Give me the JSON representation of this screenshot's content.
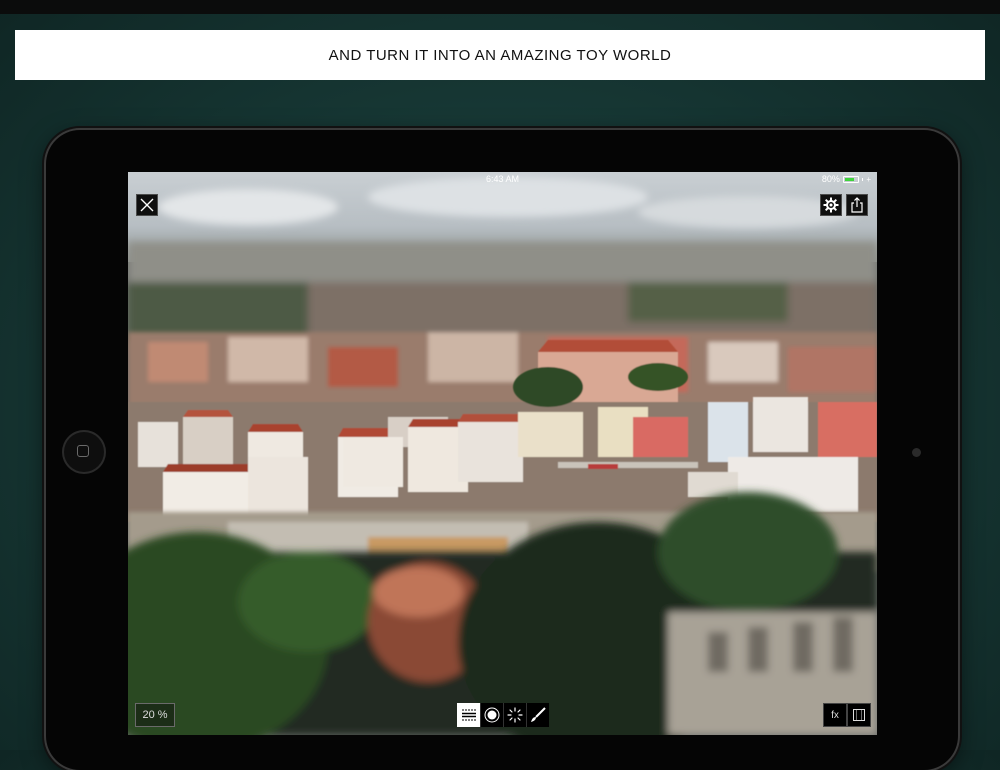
{
  "banner": {
    "text": "AND TURN IT INTO AN AMAZING TOY WORLD"
  },
  "status_bar": {
    "time": "6:43 AM",
    "battery_percent": "80%",
    "battery_level": 0.8
  },
  "top_left": {
    "icon": "close-icon"
  },
  "top_right": {
    "icons": [
      "gear-icon",
      "share-icon"
    ]
  },
  "bottom_left": {
    "zoom_label": "20 %"
  },
  "tools": [
    {
      "icon": "linear-blur-icon",
      "active": true
    },
    {
      "icon": "radial-blur-icon",
      "active": false
    },
    {
      "icon": "spinner-icon",
      "active": false
    },
    {
      "icon": "brush-icon",
      "active": false
    }
  ],
  "bottom_right": {
    "fx_label": "fx",
    "frame_icon": "frame-icon"
  },
  "colors": {
    "background": "#163633",
    "battery_fill": "#3fd43c",
    "active_tool": "#ffffff"
  }
}
